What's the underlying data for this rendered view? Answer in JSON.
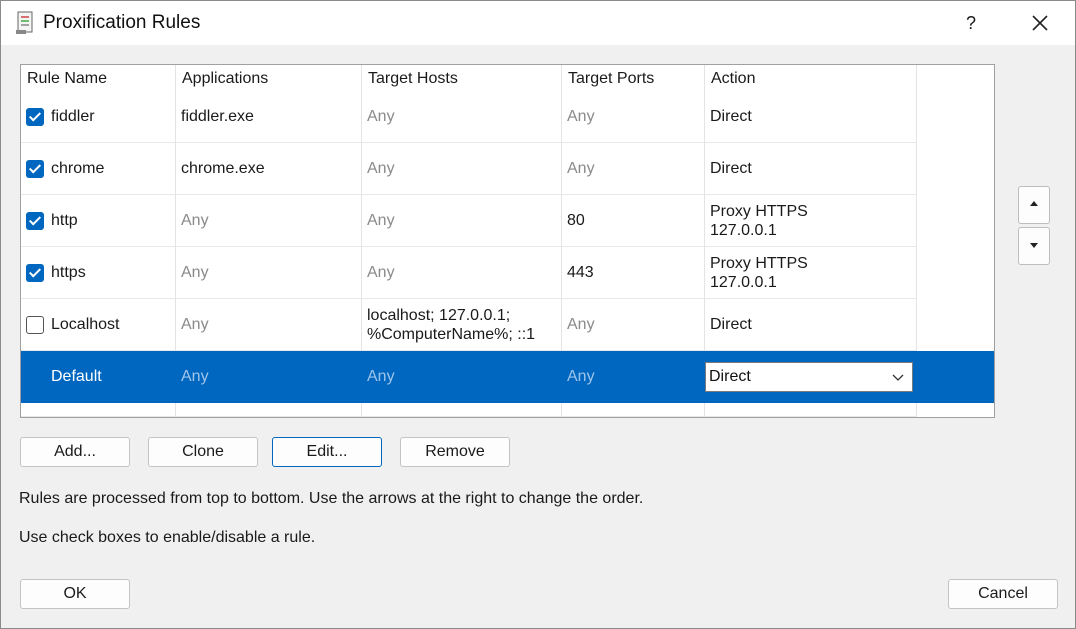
{
  "window": {
    "title": "Proxification Rules",
    "help_label": "?"
  },
  "grid": {
    "columns": [
      "Rule Name",
      "Applications",
      "Target Hosts",
      "Target Ports",
      "Action"
    ],
    "rows": [
      {
        "name": "fiddler",
        "enabled": true,
        "applications": "fiddler.exe",
        "hosts": "Any",
        "ports": "Any",
        "action": "Direct"
      },
      {
        "name": "chrome",
        "enabled": true,
        "applications": "chrome.exe",
        "hosts": "Any",
        "ports": "Any",
        "action": "Direct"
      },
      {
        "name": "http",
        "enabled": true,
        "applications": "Any",
        "hosts": "Any",
        "ports": "80",
        "action_line1": "Proxy HTTPS",
        "action_line2": "127.0.0.1"
      },
      {
        "name": "https",
        "enabled": true,
        "applications": "Any",
        "hosts": "Any",
        "ports": "443",
        "action_line1": "Proxy HTTPS",
        "action_line2": "127.0.0.1"
      },
      {
        "name": "Localhost",
        "enabled": false,
        "applications": "Any",
        "hosts_line1": "localhost; 127.0.0.1;",
        "hosts_line2": "%ComputerName%; ::1",
        "ports": "Any",
        "action": "Direct"
      },
      {
        "name": "Default",
        "applications": "Any",
        "hosts": "Any",
        "ports": "Any",
        "action_select": "Direct"
      }
    ]
  },
  "buttons": {
    "add": "Add...",
    "clone": "Clone",
    "edit": "Edit...",
    "remove": "Remove",
    "ok": "OK",
    "cancel": "Cancel"
  },
  "info": {
    "line1": "Rules are processed from top to bottom. Use the arrows at the right to change the order.",
    "line2": "Use check boxes to enable/disable a rule."
  },
  "colors": {
    "accent": "#0067c0",
    "dim_text": "#8a8a8a"
  },
  "icons": {
    "app": "document-icon",
    "close": "close-icon",
    "up": "arrow-up-icon",
    "down": "arrow-down-icon",
    "dropdown": "chevron-down-icon"
  }
}
